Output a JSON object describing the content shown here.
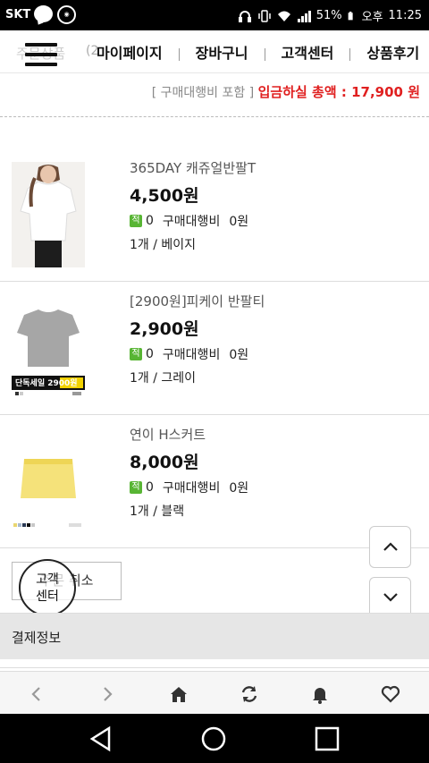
{
  "status_bar": {
    "carrier": "SKT",
    "battery": "51%",
    "ampm": "오후",
    "time": "11:25"
  },
  "top_nav": {
    "hidden_label": "주문상품",
    "hidden_count": "(2",
    "links": [
      "마이페이지",
      "장바구니",
      "고객센터",
      "상품후기"
    ]
  },
  "summary": {
    "prefix": "[ 구매대행비 포함 ]",
    "label": "입금하실 총액 : 17,900 원"
  },
  "products": [
    {
      "name": "365DAY 캐쥬얼반팔T",
      "price": "4,500원",
      "points_badge": "적",
      "points": "0",
      "fee_label": "구매대행비",
      "fee": "0원",
      "option": "1개 / 베이지"
    },
    {
      "name": "[2900원]피케이 반팔티",
      "price": "2,900원",
      "points_badge": "적",
      "points": "0",
      "fee_label": "구매대행비",
      "fee": "0원",
      "option": "1개 / 그레이",
      "thumb_caption": "단독세일 2900원"
    },
    {
      "name": "연이 H스커트",
      "price": "8,000원",
      "points_badge": "적",
      "points": "0",
      "fee_label": "구매대행비",
      "fee": "0원",
      "option": "1개 / 블랙"
    }
  ],
  "cancel_button": "주문 취소",
  "customer_center": {
    "line1": "고객",
    "line2": "센터"
  },
  "payment_section": "결제정보",
  "browser_bar_icons": [
    "back-icon",
    "forward-icon",
    "home-icon",
    "refresh-icon",
    "bell-icon",
    "heart-icon"
  ],
  "android_nav_icons": [
    "back-triangle-icon",
    "home-circle-icon",
    "recents-square-icon"
  ],
  "colors": {
    "accent_red": "#e02020",
    "badge_green": "#58b534"
  }
}
